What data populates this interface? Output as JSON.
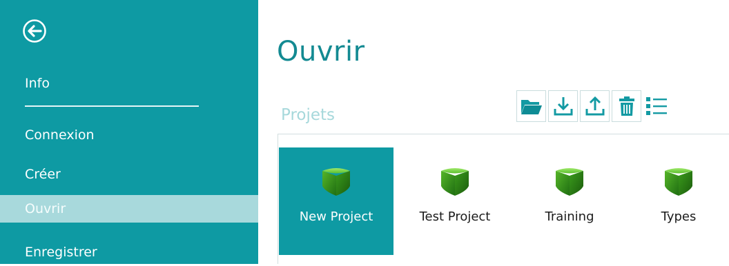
{
  "sidebar": {
    "back_icon": "back-arrow-circle-icon",
    "items": [
      {
        "label": "Info"
      },
      {
        "label": "Connexion"
      },
      {
        "label": "Créer"
      },
      {
        "label": "Ouvrir",
        "selected": true
      },
      {
        "label": "Enregistrer"
      }
    ]
  },
  "main": {
    "title": "Ouvrir",
    "section_title": "Projets",
    "toolbar": [
      {
        "icon": "folder-open-icon"
      },
      {
        "icon": "download-icon"
      },
      {
        "icon": "upload-icon"
      },
      {
        "icon": "trash-icon"
      },
      {
        "icon": "list-view-icon"
      }
    ],
    "projects": [
      {
        "label": "New Project",
        "selected": true
      },
      {
        "label": "Test Project"
      },
      {
        "label": "Training"
      },
      {
        "label": "Types"
      }
    ]
  },
  "colors": {
    "accent": "#0e9aa3",
    "selected_sidebar": "#a8d9dc",
    "title": "#138a92",
    "section": "#a6d8db"
  }
}
